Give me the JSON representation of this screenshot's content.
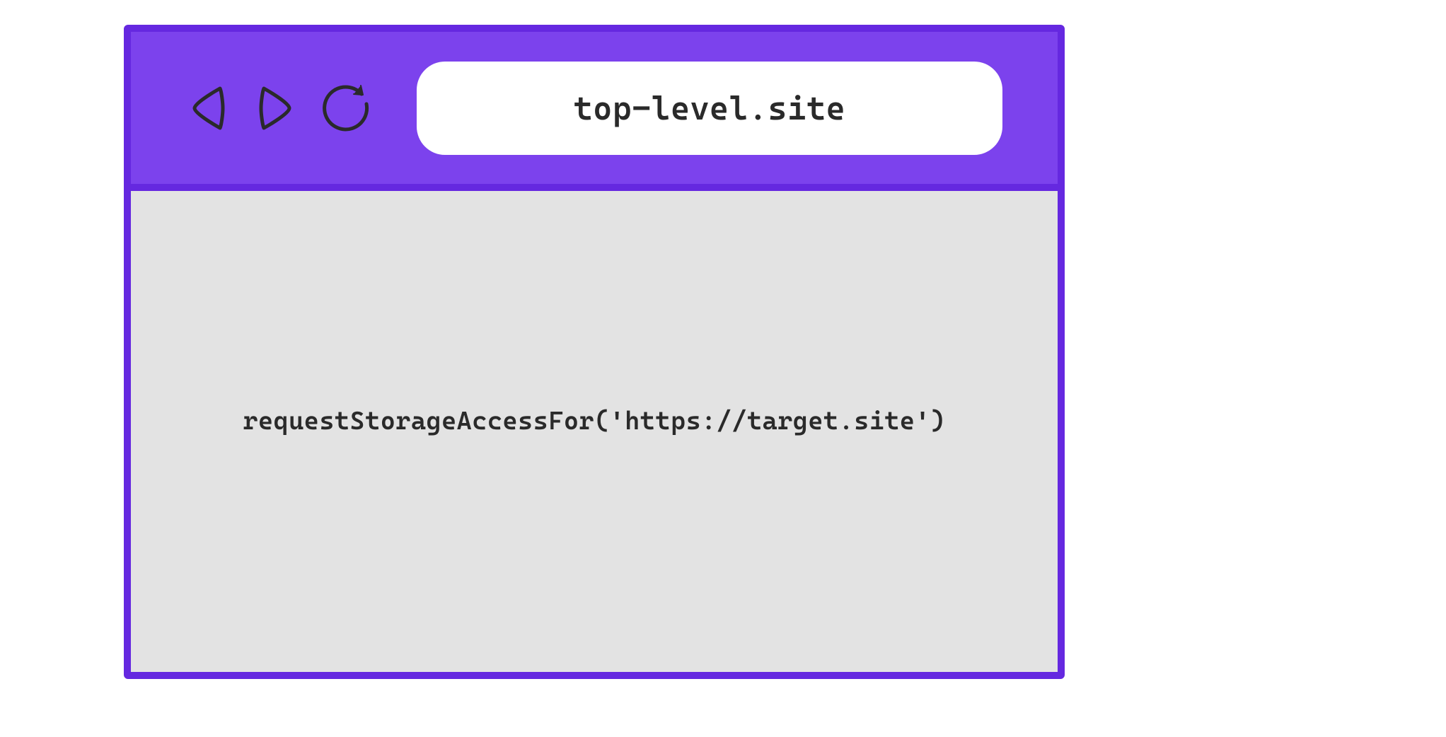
{
  "window": {
    "address": "top-level.site",
    "content_code": "requestStorageAccessFor('https://target.site')"
  },
  "colors": {
    "toolbar_bg": "#7c42ed",
    "border": "#6528e0",
    "viewport_bg": "#e3e3e3",
    "text": "#2a2a2a"
  }
}
